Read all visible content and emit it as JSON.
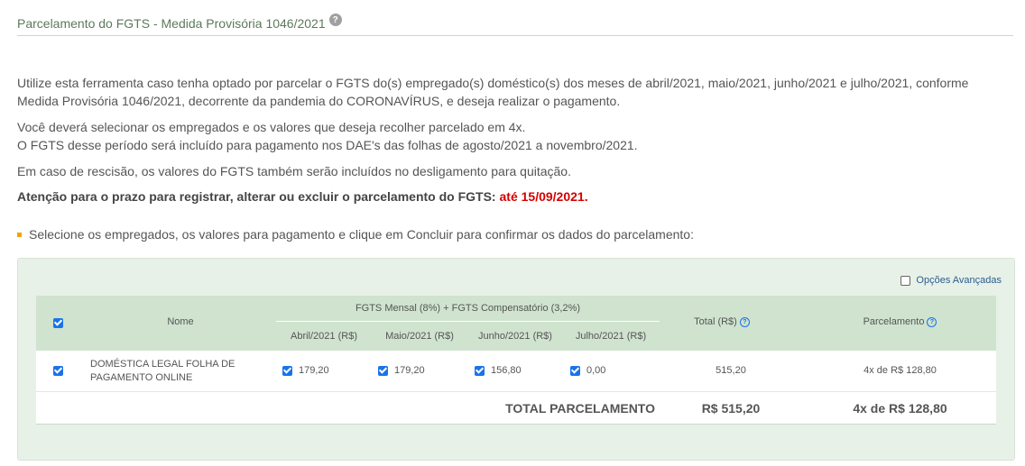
{
  "header": {
    "title": "Parcelamento do FGTS - Medida Provisória 1046/2021",
    "help": "?"
  },
  "intro": {
    "p1": "Utilize esta ferramenta caso tenha optado por parcelar o FGTS do(s) empregado(s) doméstico(s) dos meses de abril/2021, maio/2021, junho/2021 e julho/2021, conforme Medida Provisória 1046/2021, decorrente da pandemia do CORONAVÍRUS, e deseja realizar o pagamento.",
    "p2a": "Você deverá selecionar os empregados e os valores que deseja recolher parcelado em 4x.",
    "p2b": "O FGTS desse período será incluído para pagamento nos DAE's das folhas de agosto/2021 a novembro/2021.",
    "p3": "Em caso de rescisão, os valores do FGTS também serão incluídos no desligamento para quitação.",
    "p4": "Atenção para o prazo para registrar, alterar ou excluir o parcelamento do FGTS:",
    "deadline": "até 15/09/2021."
  },
  "instruction": "Selecione os empregados, os valores para pagamento e clique em Concluir para confirmar os dados do parcelamento:",
  "advanced": {
    "label": "Opções Avançadas",
    "checked": false
  },
  "table": {
    "col_name": "Nome",
    "group_header": "FGTS Mensal (8%) + FGTS Compensatório (3,2%)",
    "months": [
      "Abril/2021 (R$)",
      "Maio/2021 (R$)",
      "Junho/2021 (R$)",
      "Julho/2021 (R$)"
    ],
    "col_total": "Total (R$)",
    "col_parcelamento": "Parcelamento",
    "help": "?",
    "rows": [
      {
        "name_line1": "DOMÉSTICA LEGAL FOLHA DE",
        "name_line2": "PAGAMENTO ONLINE",
        "values": [
          "179,20",
          "179,20",
          "156,80",
          "0,00"
        ],
        "total": "515,20",
        "parcelamento": "4x de R$ 128,80"
      }
    ],
    "footer": {
      "label": "TOTAL PARCELAMENTO",
      "total": "R$ 515,20",
      "parcelamento": "4x de R$ 128,80"
    }
  },
  "colors": {
    "accent": "#1a73e8",
    "panel_bg": "#e8f1e8",
    "header_bg": "#cfe3cf",
    "deadline": "#d40000",
    "bullet": "#f0a500"
  }
}
